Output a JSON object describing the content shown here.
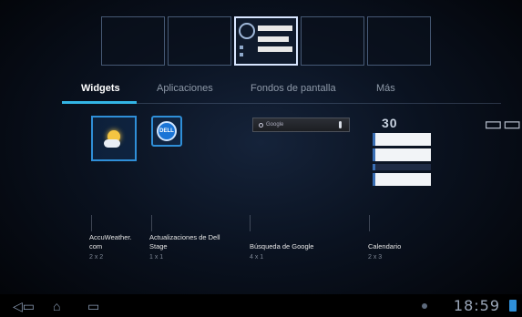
{
  "tabs": [
    {
      "label": "Widgets",
      "selected": true
    },
    {
      "label": "Aplicaciones",
      "selected": false
    },
    {
      "label": "Fondos de pantalla",
      "selected": false
    },
    {
      "label": "Más",
      "selected": false
    }
  ],
  "widgets": [
    {
      "name_line1": "AccuWeather.",
      "name_line2": "com",
      "size": "2 x 2",
      "icon": "weather-icon"
    },
    {
      "name_line1": "Actualizaciones de Dell",
      "name_line2": "Stage",
      "size": "1 x 1",
      "icon": "dell-icon"
    },
    {
      "name_line1": "Búsqueda de Google",
      "name_line2": "",
      "size": "4 x 1",
      "icon": "google-search-icon"
    },
    {
      "name_line1": "Calendario",
      "name_line2": "",
      "size": "2 x 3",
      "icon": "calendar-icon"
    }
  ],
  "previews": {
    "search_hint": "Google",
    "calendar_day": "30",
    "dell_logo": "DELL"
  },
  "system_bar": {
    "time": "18:59"
  },
  "colors": {
    "accent": "#33b5e5",
    "icon_border": "#2f8fd8"
  }
}
